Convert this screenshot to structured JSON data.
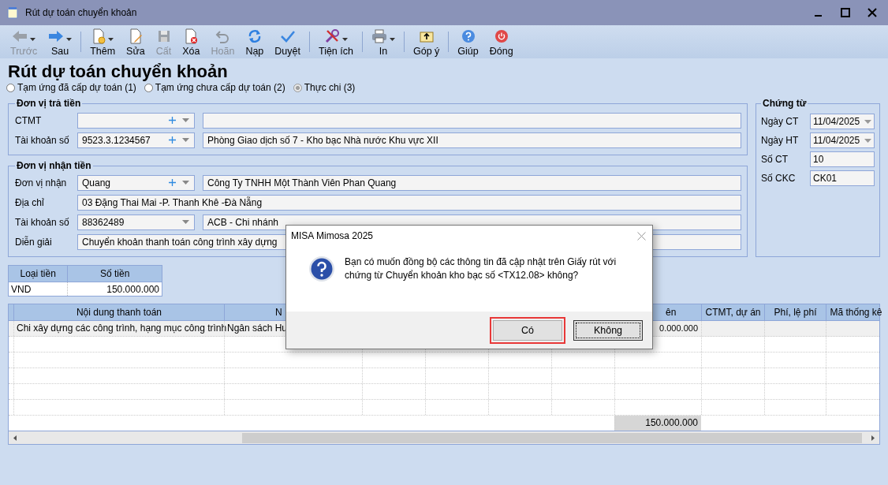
{
  "window": {
    "title": "Rút dự toán chuyển khoản"
  },
  "toolbar": {
    "groups": [
      [
        {
          "label": "Trước",
          "disabled": true,
          "dropdown": true
        },
        {
          "label": "Sau",
          "disabled": false,
          "dropdown": true
        }
      ],
      [
        {
          "label": "Thêm",
          "disabled": false,
          "dropdown": true
        },
        {
          "label": "Sửa",
          "disabled": false,
          "dropdown": false
        },
        {
          "label": "Cất",
          "disabled": true,
          "dropdown": false
        },
        {
          "label": "Xóa",
          "disabled": false,
          "dropdown": false
        },
        {
          "label": "Hoãn",
          "disabled": true,
          "dropdown": false
        },
        {
          "label": "Nạp",
          "disabled": false,
          "dropdown": false
        },
        {
          "label": "Duyệt",
          "disabled": false,
          "dropdown": false
        }
      ],
      [
        {
          "label": "Tiện ích",
          "disabled": false,
          "dropdown": true
        }
      ],
      [
        {
          "label": "In",
          "disabled": false,
          "dropdown": true
        }
      ],
      [
        {
          "label": "Góp ý",
          "disabled": false,
          "dropdown": false
        }
      ],
      [
        {
          "label": "Giúp",
          "disabled": false,
          "dropdown": false
        },
        {
          "label": "Đóng",
          "disabled": false,
          "dropdown": false
        }
      ]
    ]
  },
  "heading": "Rút dự toán chuyển khoản",
  "payment_types": [
    {
      "label": "Tạm ứng đã cấp dự toán (1)",
      "selected": false
    },
    {
      "label": "Tạm ứng chưa cấp dự toán (2)",
      "selected": false
    },
    {
      "label": "Thực chi (3)",
      "selected": true
    }
  ],
  "payer": {
    "title": "Đơn vị trả tiền",
    "rows": [
      {
        "label": "CTMT",
        "kind": "lookup"
      },
      {
        "label": "Tài khoản số",
        "kind": "lookup",
        "code": "9523.3.1234567",
        "name": "Phòng Giao dịch số 7 - Kho bạc Nhà nước Khu vực XII"
      }
    ]
  },
  "payee": {
    "title": "Đơn vị nhận tiền",
    "rows": [
      {
        "label": "Đơn vị nhận",
        "kind": "lookup",
        "code": "Quang",
        "name": "Công Ty TNHH Một Thành Viên Phan Quang"
      },
      {
        "label": "Địa chỉ",
        "kind": "text",
        "name": "03 Đặng Thai Mai -P. Thanh Khê -Đà Nẵng"
      },
      {
        "label": "Tài khoản số",
        "kind": "select",
        "code": "88362489",
        "name": "ACB - Chi nhánh"
      },
      {
        "label": "Diễn giải",
        "kind": "text",
        "name": "Chuyển khoản thanh toán công trình xây dựng"
      }
    ]
  },
  "document": {
    "title": "Chứng từ",
    "rows": [
      {
        "label": "Ngày CT",
        "kind": "date",
        "value": "11/04/2025"
      },
      {
        "label": "Ngày HT",
        "kind": "date",
        "value": "11/04/2025"
      },
      {
        "label": "Số CT",
        "kind": "text",
        "value": "10"
      },
      {
        "label": "Số CKC",
        "kind": "text",
        "value": "CK01"
      }
    ]
  },
  "currency_table": {
    "columns": [
      "Loại tiền",
      "Số tiền"
    ],
    "rows": [
      [
        "VND",
        "150.000.000"
      ]
    ]
  },
  "grid": {
    "columns": [
      {
        "label": "Nội dung thanh toán"
      },
      {
        "label": "N"
      },
      {},
      {},
      {},
      {},
      {
        "label": "ên"
      },
      {
        "label": "CTMT, dự án"
      },
      {
        "label": "Phí, lệ phí"
      },
      {
        "label": "Mã thống kê"
      }
    ],
    "rows": [
      {
        "selected": true,
        "cells": [
          "Chi xây dựng các công trình, hạng mục công trình",
          "Ngân sách Hu",
          null,
          null,
          null,
          null,
          "0.000.000",
          null,
          null,
          null
        ]
      }
    ],
    "total": "150.000.000"
  },
  "dialog": {
    "title": "MISA Mimosa 2025",
    "message": "Bạn có muốn đồng bộ các thông tin đã cập nhật trên Giấy rút với chứng từ Chuyển khoản kho bạc số <TX12.08> không?",
    "buttons": [
      {
        "label": "Có",
        "highlighted": true,
        "focused": false
      },
      {
        "label": "Không",
        "highlighted": false,
        "focused": true
      }
    ]
  }
}
